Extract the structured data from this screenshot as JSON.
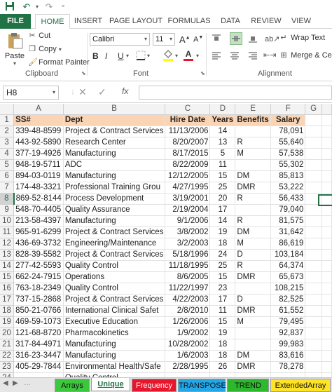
{
  "qat": {
    "save_icon": "save-icon",
    "undo_icon": "undo-icon",
    "redo_icon": "redo-icon"
  },
  "tabs": [
    "FILE",
    "HOME",
    "INSERT",
    "PAGE LAYOUT",
    "FORMULAS",
    "DATA",
    "REVIEW",
    "VIEW"
  ],
  "active_tab": "HOME",
  "colors": {
    "excel_green": "#217346",
    "header_fill": "#fbd4b4"
  },
  "clipboard": {
    "cut": "Cut",
    "copy": "Copy",
    "format_painter": "Format Painter",
    "paste": "Paste",
    "label": "Clipboard"
  },
  "font": {
    "name": "Calibri",
    "size": "11",
    "label": "Font",
    "bold": "B",
    "italic": "I",
    "underline": "U",
    "font_color_letter": "A"
  },
  "alignment": {
    "wrap_text": "Wrap Text",
    "merge": "Merge & Cent",
    "label": "Alignment"
  },
  "formula_bar": {
    "name_box": "H8",
    "fx": "fx",
    "value": ""
  },
  "columns": [
    "A",
    "B",
    "C",
    "D",
    "E",
    "F",
    "G"
  ],
  "selected_row": 8,
  "rows": [
    {
      "n": "1",
      "a": "SS#",
      "b": "Dept",
      "c": "Hire Date",
      "d": "Years",
      "e": "Benefits",
      "f": "Salary"
    },
    {
      "n": "2",
      "a": "339-48-8599",
      "b": "Project & Contract Services",
      "c": "11/13/2006",
      "d": "14",
      "e": "",
      "f": "78,091"
    },
    {
      "n": "3",
      "a": "443-92-5890",
      "b": "Research Center",
      "c": "8/20/2007",
      "d": "13",
      "e": "R",
      "f": "55,640"
    },
    {
      "n": "4",
      "a": "377-19-4926",
      "b": "Manufacturing",
      "c": "8/17/2015",
      "d": "5",
      "e": "M",
      "f": "57,538"
    },
    {
      "n": "5",
      "a": "948-19-5711",
      "b": "ADC",
      "c": "8/22/2009",
      "d": "11",
      "e": "",
      "f": "55,302"
    },
    {
      "n": "6",
      "a": "894-03-0119",
      "b": "Manufacturing",
      "c": "12/12/2005",
      "d": "15",
      "e": "DM",
      "f": "85,813"
    },
    {
      "n": "7",
      "a": "174-48-3321",
      "b": "Professional Training Grou",
      "c": "4/27/1995",
      "d": "25",
      "e": "DMR",
      "f": "53,222"
    },
    {
      "n": "8",
      "a": "869-52-8144",
      "b": "Process Development",
      "c": "3/19/2001",
      "d": "20",
      "e": "R",
      "f": "56,433"
    },
    {
      "n": "9",
      "a": "548-70-4405",
      "b": "Quality Assurance",
      "c": "2/19/2004",
      "d": "17",
      "e": "",
      "f": "79,040"
    },
    {
      "n": "10",
      "a": "213-58-4397",
      "b": "Manufacturing",
      "c": "9/1/2006",
      "d": "14",
      "e": "R",
      "f": "81,575"
    },
    {
      "n": "11",
      "a": "965-91-6299",
      "b": "Project & Contract Services",
      "c": "3/8/2002",
      "d": "19",
      "e": "DM",
      "f": "31,642"
    },
    {
      "n": "12",
      "a": "436-69-3732",
      "b": "Engineering/Maintenance",
      "c": "3/2/2003",
      "d": "18",
      "e": "M",
      "f": "86,619"
    },
    {
      "n": "13",
      "a": "828-39-5582",
      "b": "Project & Contract Services",
      "c": "5/18/1996",
      "d": "24",
      "e": "D",
      "f": "103,184"
    },
    {
      "n": "14",
      "a": "277-42-5593",
      "b": "Quality Control",
      "c": "11/18/1995",
      "d": "25",
      "e": "R",
      "f": "64,374"
    },
    {
      "n": "15",
      "a": "662-24-7915",
      "b": "Operations",
      "c": "8/6/2005",
      "d": "15",
      "e": "DMR",
      "f": "65,673"
    },
    {
      "n": "16",
      "a": "763-18-2349",
      "b": "Quality Control",
      "c": "11/22/1997",
      "d": "23",
      "e": "",
      "f": "108,215"
    },
    {
      "n": "17",
      "a": "737-15-2868",
      "b": "Project & Contract Services",
      "c": "4/22/2003",
      "d": "17",
      "e": "D",
      "f": "82,525"
    },
    {
      "n": "18",
      "a": "850-21-0766",
      "b": "International Clinical Safet",
      "c": "2/8/2010",
      "d": "11",
      "e": "DMR",
      "f": "61,552"
    },
    {
      "n": "19",
      "a": "469-59-1073",
      "b": "Executive Education",
      "c": "1/26/2006",
      "d": "15",
      "e": "M",
      "f": "79,495"
    },
    {
      "n": "20",
      "a": "121-68-8720",
      "b": "Pharmacokinetics",
      "c": "1/9/2002",
      "d": "19",
      "e": "",
      "f": "92,837"
    },
    {
      "n": "21",
      "a": "317-84-4971",
      "b": "Manufacturing",
      "c": "10/28/2002",
      "d": "18",
      "e": "",
      "f": "99,983"
    },
    {
      "n": "22",
      "a": "316-23-3447",
      "b": "Manufacturing",
      "c": "1/6/2003",
      "d": "18",
      "e": "DM",
      "f": "83,616"
    },
    {
      "n": "23",
      "a": "405-29-7844",
      "b": "Environmental Health/Safe",
      "c": "2/28/1995",
      "d": "26",
      "e": "DMR",
      "f": "78,278"
    },
    {
      "n": "24",
      "a": "",
      "b": "Quality Control",
      "c": "",
      "d": "",
      "e": "",
      "f": ""
    }
  ],
  "sheet_tabs": [
    {
      "label": "Arrays",
      "color": "#3cc83c",
      "active": false
    },
    {
      "label": "Unique",
      "color": "#ffffff",
      "active": true
    },
    {
      "label": "Frequency",
      "color": "#e6162d",
      "active": false
    },
    {
      "label": "TRANSPOSE",
      "color": "#22a7e8",
      "active": false
    },
    {
      "label": "TREND",
      "color": "#2eb82e",
      "active": false
    },
    {
      "label": "ExtendedArray",
      "color": "#ffe326",
      "active": false
    }
  ]
}
